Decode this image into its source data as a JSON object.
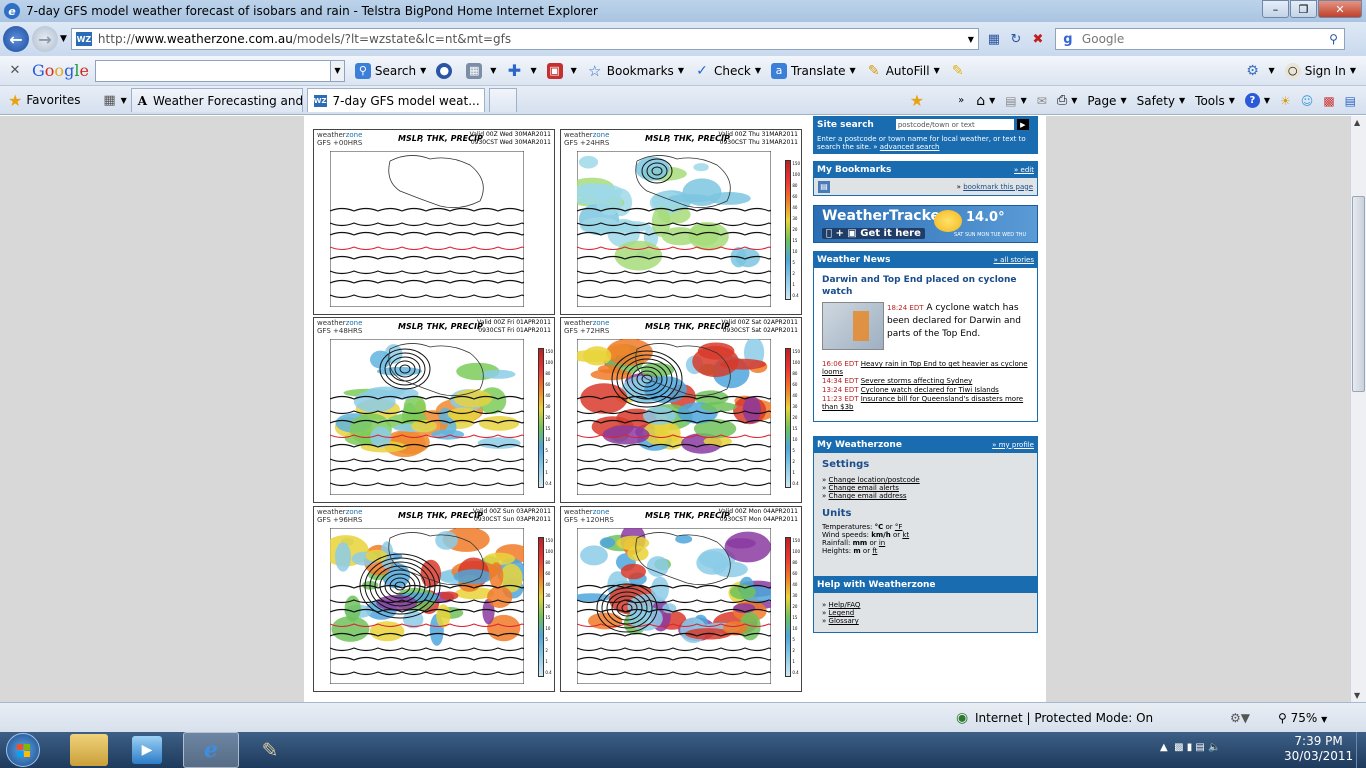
{
  "window": {
    "title": "7-day GFS model weather forecast of isobars and rain - Telstra BigPond Home Internet Explorer",
    "minimize": "–",
    "maximize": "❐",
    "close": "✕"
  },
  "address_bar": {
    "url_prefix": "http://",
    "url_domain": "www.weatherzone.com.au",
    "url_path": "/models/?lt=wzstate&lc=nt&mt=gfs",
    "favicon_text": "WZ",
    "search_placeholder": "Google"
  },
  "google_toolbar": {
    "logo": [
      "G",
      "o",
      "o",
      "g",
      "l",
      "e"
    ],
    "search": "Search",
    "bookmarks": "Bookmarks",
    "check": "Check",
    "translate": "Translate",
    "autofill": "AutoFill",
    "sign_in": "Sign In"
  },
  "favorites_bar": {
    "favorites": "Favorites",
    "tabs": [
      {
        "label": "Weather Forecasting and ..."
      },
      {
        "label": "7-day GFS model weat..."
      }
    ],
    "commands": {
      "page": "Page",
      "safety": "Safety",
      "tools": "Tools"
    }
  },
  "charts": [
    {
      "brand_a": "weather",
      "brand_b": "zone",
      "run": "GFS  +00HRS",
      "title": "MSLP, THK, PRECIP",
      "valid": "Valid 00Z  Wed  30MAR2011",
      "local": "0930CST  Wed  30MAR2011",
      "rain": "none"
    },
    {
      "brand_a": "weather",
      "brand_b": "zone",
      "run": "GFS  +24HRS",
      "title": "MSLP, THK, PRECIP",
      "valid": "Valid 00Z  Thu  31MAR2011",
      "local": "0930CST  Thu  31MAR2011",
      "rain": "light"
    },
    {
      "brand_a": "weather",
      "brand_b": "zone",
      "run": "GFS  +48HRS",
      "title": "MSLP, THK, PRECIP",
      "valid": "Valid 00Z  Fri  01APR2011",
      "local": "0930CST  Fri  01APR2011",
      "rain": "moderate"
    },
    {
      "brand_a": "weather",
      "brand_b": "zone",
      "run": "GFS  +72HRS",
      "title": "MSLP, THK, PRECIP",
      "valid": "Valid 00Z  Sat  02APR2011",
      "local": "0930CST  Sat  02APR2011",
      "rain": "heavy"
    },
    {
      "brand_a": "weather",
      "brand_b": "zone",
      "run": "GFS  +96HRS",
      "title": "MSLP, THK, PRECIP",
      "valid": "Valid 00Z  Sun  03APR2011",
      "local": "0930CST  Sun  03APR2011",
      "rain": "heavy"
    },
    {
      "brand_a": "weather",
      "brand_b": "zone",
      "run": "GFS  +120HRS",
      "title": "MSLP, THK, PRECIP",
      "valid": "Valid 00Z  Mon  04APR2011",
      "local": "0930CST  Mon  04APR2011",
      "rain": "heavy"
    }
  ],
  "colorbar_labels": [
    "150",
    "100",
    "80",
    "60",
    "40",
    "30",
    "20",
    "15",
    "10",
    "5",
    "2",
    "1",
    "0.4"
  ],
  "sidebar": {
    "site_search": {
      "heading": "Site search",
      "input_value": "postcode/town or text",
      "help": "Enter a postcode or town name for local weather, or text to search the site.",
      "advanced": "advanced search"
    },
    "bookmarks": {
      "heading": "My Bookmarks",
      "edit": "edit",
      "bookmark_this": "bookmark this page"
    },
    "weathertracker": {
      "title": "WeatherTracker",
      "get_it": "Get it here",
      "temp": "14.0°",
      "days": "SAT SUN MON TUE WED THU"
    },
    "news": {
      "heading": "Weather News",
      "all_stories": "all stories",
      "lead_title": "Darwin and Top End placed on cyclone watch",
      "lead_time": "18:24 EDT",
      "lead_text": "A cyclone watch has been declared for Darwin and parts of the Top End.",
      "items": [
        {
          "time": "16:06 EDT",
          "text": "Heavy rain in Top End to get heavier as cyclone looms"
        },
        {
          "time": "14:34 EDT",
          "text": "Severe storms affecting Sydney"
        },
        {
          "time": "13:24 EDT",
          "text": "Cyclone watch declared for Tiwi Islands"
        },
        {
          "time": "11:23 EDT",
          "text": "Insurance bill for Queensland's disasters more than $3b"
        }
      ]
    },
    "my_weatherzone": {
      "heading": "My Weatherzone",
      "profile": "my profile",
      "settings_title": "Settings",
      "settings": [
        "Change location/postcode",
        "Change email alerts",
        "Change email address"
      ],
      "units_title": "Units",
      "units": [
        {
          "label": "Temperatures:",
          "a": "°C",
          "or": "or",
          "b": "°F"
        },
        {
          "label": "Wind speeds:",
          "a": "km/h",
          "or": "or",
          "b": "kt"
        },
        {
          "label": "Rainfall:",
          "a": "mm",
          "or": "or",
          "b": "in"
        },
        {
          "label": "Heights:",
          "a": "m",
          "or": "or",
          "b": "ft"
        }
      ]
    },
    "help": {
      "heading": "Help with Weatherzone",
      "items": [
        "Help/FAQ",
        "Legend",
        "Glossary"
      ]
    }
  },
  "status_bar": {
    "zone": "Internet | Protected Mode: On",
    "zoom": "75%"
  },
  "taskbar": {
    "time": "7:39 PM",
    "date": "30/03/2011"
  }
}
